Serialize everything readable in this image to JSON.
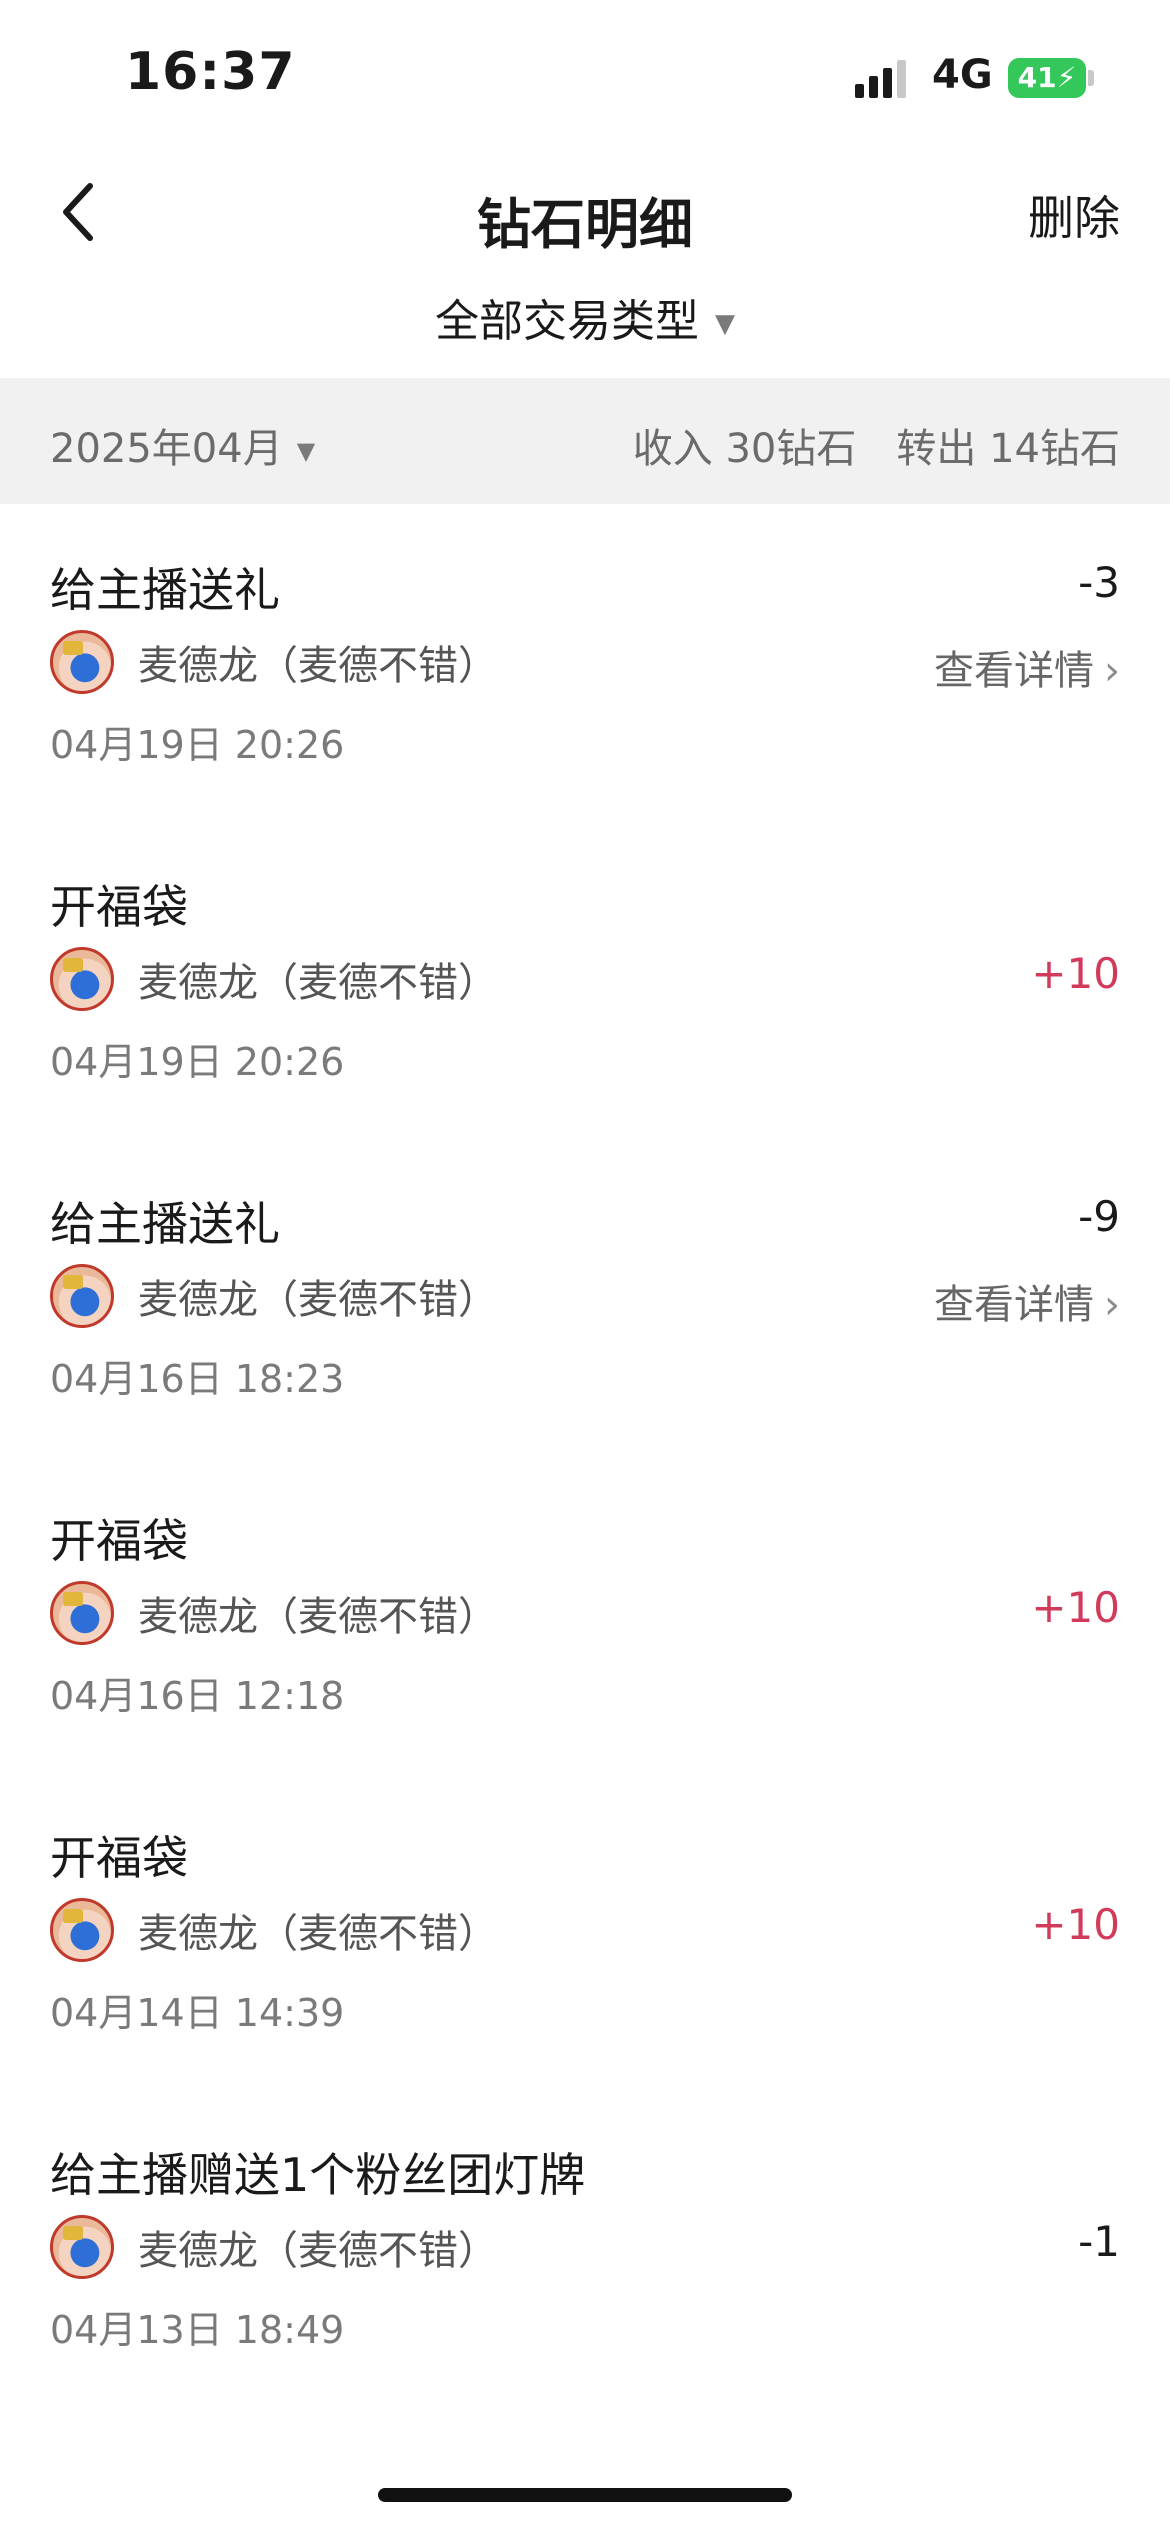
{
  "status_bar": {
    "time": "16:37",
    "network": "4G",
    "battery": "41"
  },
  "nav": {
    "title": "钻石明细",
    "delete_label": "删除"
  },
  "filter": {
    "type_label": "全部交易类型"
  },
  "summary": {
    "month": "2025年04月",
    "income": "收入 30钻石",
    "outflow": "转出 14钻石"
  },
  "transactions": [
    {
      "title": "给主播送礼",
      "user": "麦德龙（麦德不错）",
      "amount": "-3",
      "detail": "查看详情",
      "time": "04月19日 20:26"
    },
    {
      "title": "开福袋",
      "user": "麦德龙（麦德不错）",
      "amount": "+10",
      "time": "04月19日 20:26"
    },
    {
      "title": "给主播送礼",
      "user": "麦德龙（麦德不错）",
      "amount": "-9",
      "detail": "查看详情",
      "time": "04月16日 18:23"
    },
    {
      "title": "开福袋",
      "user": "麦德龙（麦德不错）",
      "amount": "+10",
      "time": "04月16日 12:18"
    },
    {
      "title": "开福袋",
      "user": "麦德龙（麦德不错）",
      "amount": "+10",
      "time": "04月14日 14:39"
    },
    {
      "title": "给主播赠送1个粉丝团灯牌",
      "user": "麦德龙（麦德不错）",
      "amount": "-1",
      "time": "04月13日 18:49"
    }
  ],
  "colors": {
    "positive": "#d23a5b",
    "band": "#f1f1f1",
    "battery": "#34c759"
  }
}
